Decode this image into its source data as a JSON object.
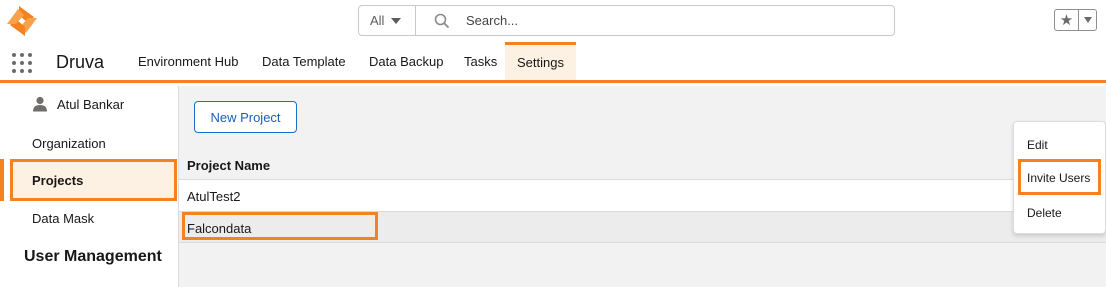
{
  "header": {
    "search_scope": "All",
    "search_placeholder": "Search..."
  },
  "nav": {
    "app_name": "Druva",
    "tabs": [
      {
        "label": "Environment Hub"
      },
      {
        "label": "Data Template"
      },
      {
        "label": "Data Backup"
      },
      {
        "label": "Tasks"
      },
      {
        "label": "Settings",
        "active": true
      }
    ]
  },
  "sidebar": {
    "user_name": "Atul Bankar",
    "items": [
      {
        "label": "Organization"
      },
      {
        "label": "Projects",
        "active": true
      },
      {
        "label": "Data Mask"
      }
    ],
    "section_heading": "User Management"
  },
  "main": {
    "new_project_label": "New Project",
    "column_header": "Project Name",
    "rows": [
      {
        "name": "AtulTest2"
      },
      {
        "name": "Falcondata",
        "highlighted": true
      }
    ]
  },
  "context_menu": {
    "items": [
      {
        "label": "Edit"
      },
      {
        "label": "Invite Users",
        "highlighted": true
      },
      {
        "label": "Delete"
      }
    ]
  },
  "colors": {
    "accent": "#f58220",
    "link_blue": "#1b5fb6"
  },
  "icons": [
    "druva-logo-icon",
    "search-icon",
    "star-icon",
    "app-launcher-icon",
    "user-icon",
    "chevron-down-icon"
  ]
}
